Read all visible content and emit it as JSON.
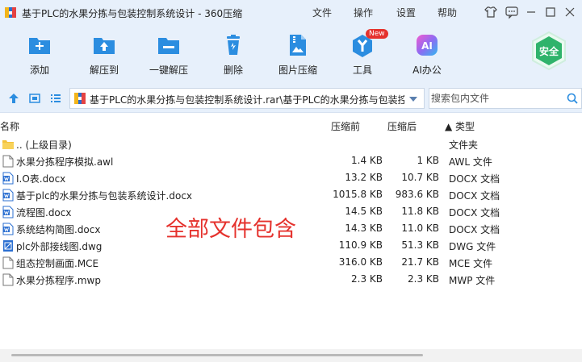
{
  "window": {
    "title": "基于PLC的水果分拣与包装控制系统设计 - 360压缩",
    "menu": [
      "文件",
      "操作",
      "设置",
      "帮助"
    ]
  },
  "toolbar": {
    "items": [
      {
        "label": "添加",
        "icon": "add-icon"
      },
      {
        "label": "解压到",
        "icon": "extract-to-icon"
      },
      {
        "label": "一键解压",
        "icon": "one-click-extract-icon"
      },
      {
        "label": "删除",
        "icon": "delete-icon"
      },
      {
        "label": "图片压缩",
        "icon": "image-compress-icon"
      },
      {
        "label": "工具",
        "icon": "tools-icon",
        "badge": "New"
      },
      {
        "label": "AI办公",
        "icon": "ai-office-icon",
        "icon_text": "AI"
      }
    ],
    "safe_label": "安全"
  },
  "address": {
    "path": "基于PLC的水果分拣与包装控制系统设计.rar\\基于PLC的水果分拣与包装控",
    "search_placeholder": "搜索包内文件"
  },
  "columns": {
    "name": "名称",
    "size": "压缩前",
    "packed": "压缩后",
    "type": "▲ 类型"
  },
  "files": [
    {
      "name": ".. (上级目录)",
      "size": "",
      "packed": "",
      "type": "文件夹",
      "icon": "folder-icon"
    },
    {
      "name": "水果分拣程序模拟.awl",
      "size": "1.4 KB",
      "packed": "1 KB",
      "type": "AWL 文件",
      "icon": "file-icon"
    },
    {
      "name": "I.O表.docx",
      "size": "13.2 KB",
      "packed": "10.7 KB",
      "type": "DOCX 文档",
      "icon": "word-icon"
    },
    {
      "name": "基于plc的水果分拣与包装系统设计.docx",
      "size": "1015.8 KB",
      "packed": "983.6 KB",
      "type": "DOCX 文档",
      "icon": "word-icon"
    },
    {
      "name": "流程图.docx",
      "size": "14.5 KB",
      "packed": "11.8 KB",
      "type": "DOCX 文档",
      "icon": "word-icon"
    },
    {
      "name": "系统结构简图.docx",
      "size": "14.3 KB",
      "packed": "11.0 KB",
      "type": "DOCX 文档",
      "icon": "word-icon"
    },
    {
      "name": "plc外部接线图.dwg",
      "size": "110.9 KB",
      "packed": "51.3 KB",
      "type": "DWG 文件",
      "icon": "dwg-icon"
    },
    {
      "name": "组态控制画面.MCE",
      "size": "316.0 KB",
      "packed": "21.7 KB",
      "type": "MCE 文件",
      "icon": "file-icon"
    },
    {
      "name": "水果分拣程序.mwp",
      "size": "2.3 KB",
      "packed": "2.3 KB",
      "type": "MWP 文件",
      "icon": "file-icon"
    }
  ],
  "overlay_note": "全部文件包含",
  "colors": {
    "chrome_bg": "#e7f0fb",
    "accent_blue": "#2b8de0",
    "overlay_red": "#e5322d",
    "safe_green": "#2fb36b"
  }
}
